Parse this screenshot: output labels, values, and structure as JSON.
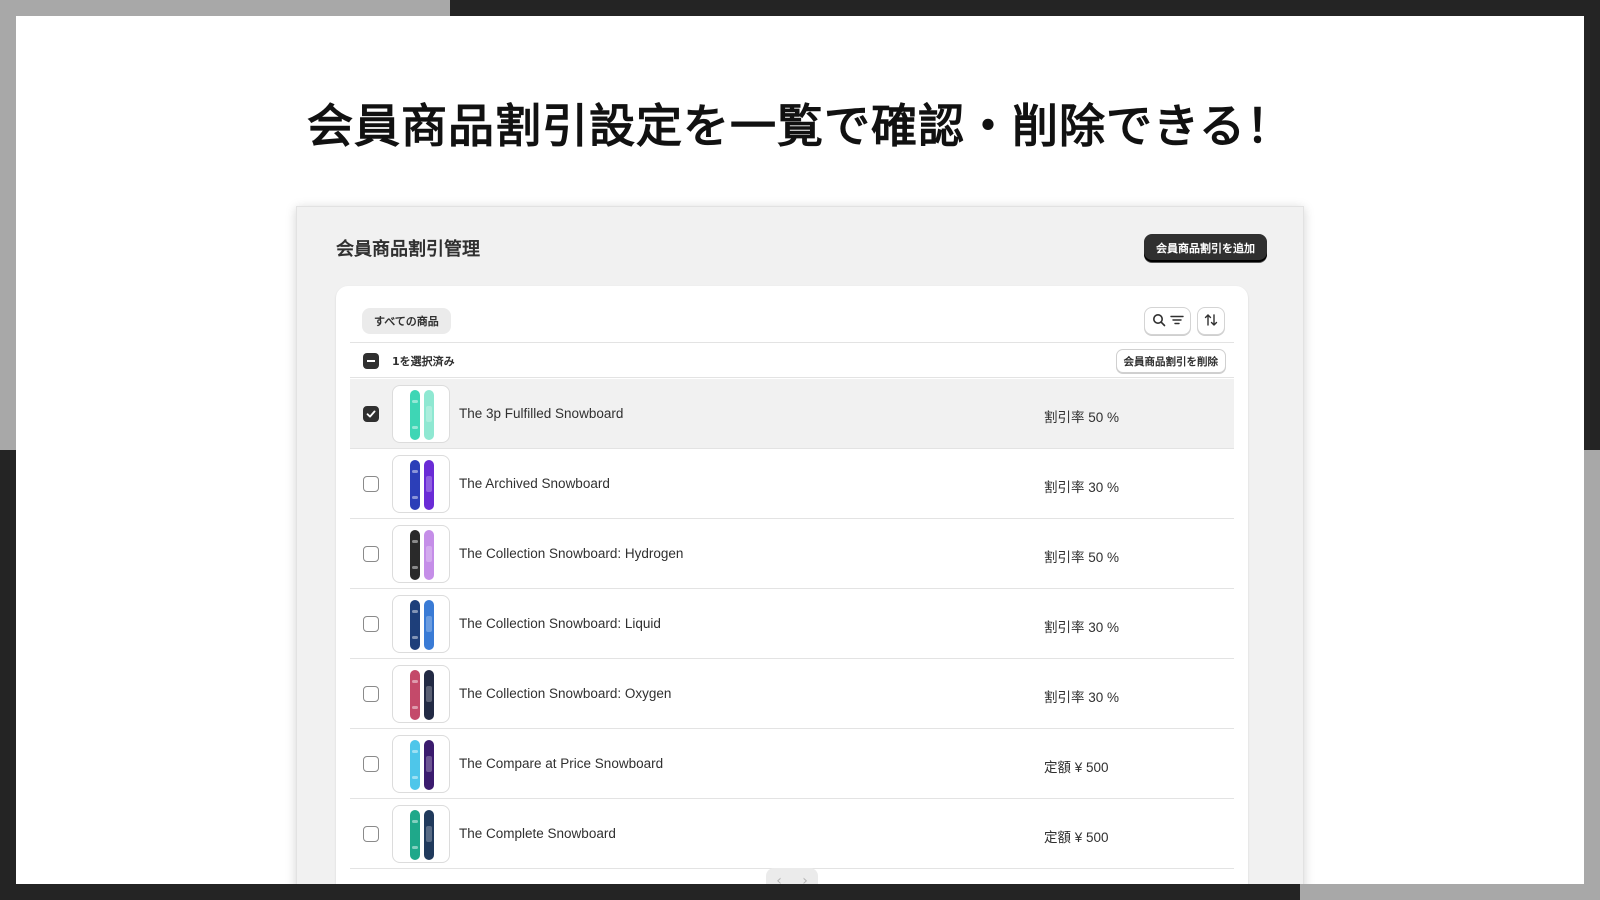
{
  "headline": "会員商品割引設定を一覧で確認・削除できる！",
  "app": {
    "page_title": "会員商品割引管理",
    "add_button": "会員商品割引を追加"
  },
  "filter": {
    "tab_all": "すべての商品",
    "search_icon": "search-icon",
    "filter_icon": "filter-lines-icon",
    "sort_icon": "sort-arrows-icon"
  },
  "selection": {
    "count_text": "1を選択済み",
    "delete_button": "会員商品割引を削除"
  },
  "products": [
    {
      "name": "The 3p Fulfilled Snowboard",
      "discount": "割引率 50 %",
      "selected": true,
      "colors": [
        "#3ed6b5",
        "#8fe8d2"
      ]
    },
    {
      "name": "The Archived Snowboard",
      "discount": "割引率 30 %",
      "selected": false,
      "colors": [
        "#2c3fb8",
        "#6a2bd6"
      ]
    },
    {
      "name": "The Collection Snowboard: Hydrogen",
      "discount": "割引率 50 %",
      "selected": false,
      "colors": [
        "#2a2a2a",
        "#c58ee8"
      ]
    },
    {
      "name": "The Collection Snowboard: Liquid",
      "discount": "割引率 30 %",
      "selected": false,
      "colors": [
        "#1e3f7a",
        "#3a7bd5"
      ]
    },
    {
      "name": "The Collection Snowboard: Oxygen",
      "discount": "割引率 30 %",
      "selected": false,
      "colors": [
        "#c44a6a",
        "#222a44"
      ]
    },
    {
      "name": "The Compare at Price Snowboard",
      "discount": "定額 ¥ 500",
      "selected": false,
      "colors": [
        "#4ec6ea",
        "#3b1b6e"
      ]
    },
    {
      "name": "The Complete Snowboard",
      "discount": "定額 ¥ 500",
      "selected": false,
      "colors": [
        "#1fa88a",
        "#203a5c"
      ]
    }
  ],
  "pagination": {
    "prev_icon": "chevron-left-icon",
    "next_icon": "chevron-right-icon"
  },
  "colors": {
    "primary_button": "#303030",
    "selected_row": "#f1f1f1",
    "surface": "#ffffff"
  }
}
